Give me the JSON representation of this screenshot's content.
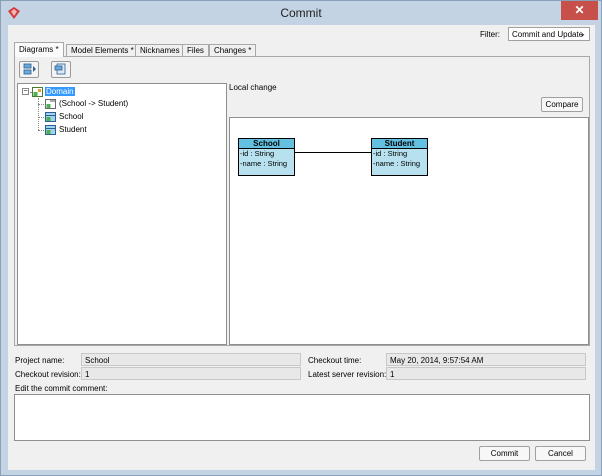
{
  "window": {
    "title": "Commit",
    "close_glyph": "✕"
  },
  "filter": {
    "label": "Filter:",
    "value": "Commit and Update"
  },
  "tabs": [
    {
      "label": "Diagrams *",
      "active": true
    },
    {
      "label": "Model Elements *",
      "active": false
    },
    {
      "label": "Nicknames",
      "active": false
    },
    {
      "label": "Files",
      "active": false
    },
    {
      "label": "Changes *",
      "active": false
    }
  ],
  "toolbar": {
    "icons": [
      "expand-all-icon",
      "collapse-all-icon"
    ]
  },
  "tree": {
    "expander_glyph": "−",
    "root": {
      "label": "Domain",
      "icon": "diagram-icon",
      "selected": true
    },
    "children": [
      {
        "label": "(School -> Student)",
        "icon": "association-icon"
      },
      {
        "label": "School",
        "icon": "class-icon"
      },
      {
        "label": "Student",
        "icon": "class-icon"
      }
    ]
  },
  "preview": {
    "label": "Local change",
    "compare_label": "Compare",
    "classes": [
      {
        "name": "School",
        "attributes": [
          "-id : String",
          "-name : String"
        ]
      },
      {
        "name": "Student",
        "attributes": [
          "-id : String",
          "-name : String"
        ]
      }
    ]
  },
  "info": {
    "project_name_label": "Project name:",
    "project_name": "School",
    "checkout_time_label": "Checkout time:",
    "checkout_time": "May 20, 2014, 9:57:54 AM",
    "checkout_revision_label": "Checkout revision:",
    "checkout_revision": "1",
    "latest_revision_label": "Latest server revision:",
    "latest_revision": "1"
  },
  "comment": {
    "label": "Edit the commit comment:",
    "value": ""
  },
  "buttons": {
    "commit": "Commit",
    "cancel": "Cancel"
  },
  "colors": {
    "selection": "#3399ff",
    "class_header": "#63c0e0",
    "class_body": "#b7e1ef",
    "close": "#c7504b"
  }
}
